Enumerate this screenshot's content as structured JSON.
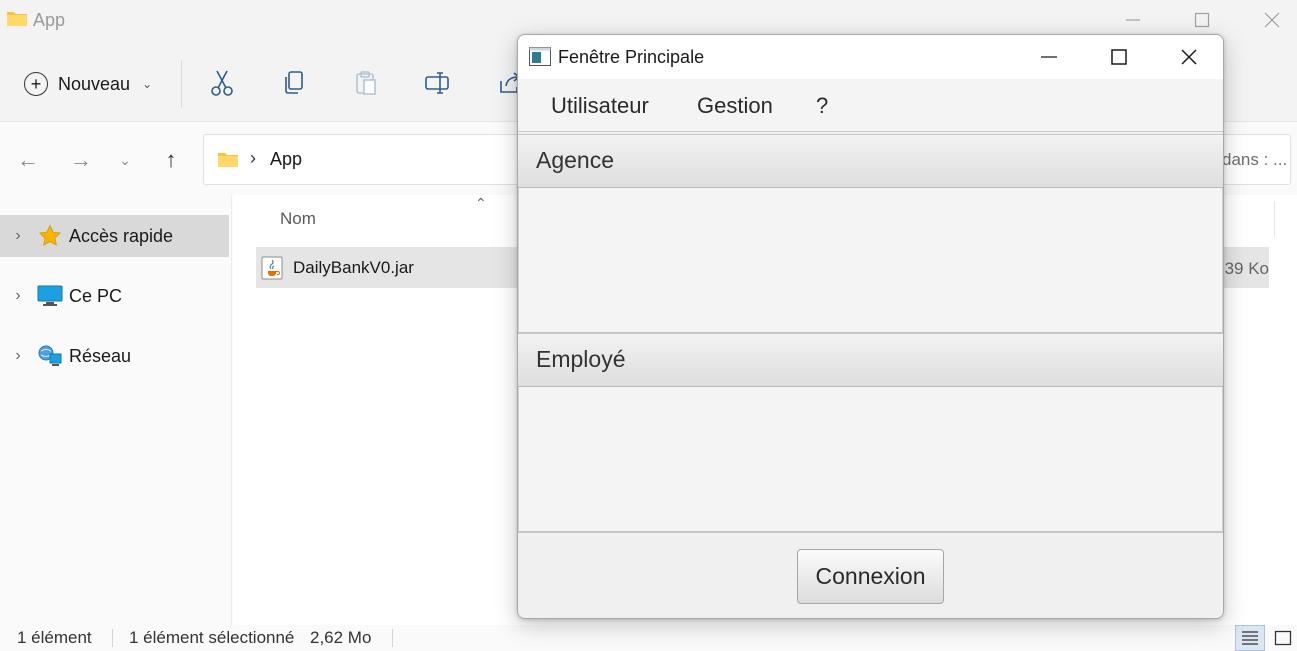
{
  "explorer": {
    "title": "App",
    "toolbar": {
      "new_label": "Nouveau"
    },
    "address": {
      "path": "App",
      "search_hint": "dans : ..."
    },
    "nav": [
      {
        "label": "Accès rapide",
        "icon": "star-icon",
        "selected": true
      },
      {
        "label": "Ce PC",
        "icon": "computer-icon",
        "selected": false
      },
      {
        "label": "Réseau",
        "icon": "network-icon",
        "selected": false
      }
    ],
    "column_header": "Nom",
    "files": [
      {
        "name": "DailyBankV0.jar",
        "size": "39 Ko",
        "icon": "java-jar-icon"
      }
    ],
    "status": {
      "count": "1 élément",
      "selection": "1 élément sélectionné",
      "selection_size": "2,62 Mo"
    }
  },
  "dialog": {
    "title": "Fenêtre Principale",
    "menus": [
      "Utilisateur",
      "Gestion",
      "?"
    ],
    "sections": [
      {
        "title": "Agence"
      },
      {
        "title": "Employé"
      }
    ],
    "connect_button": "Connexion"
  },
  "colors": {
    "folder": "#f4c542",
    "selection_bg": "#e5e5e5",
    "nav_selected_bg": "#d9d9d9",
    "dialog_bg": "#f0f0f0"
  }
}
